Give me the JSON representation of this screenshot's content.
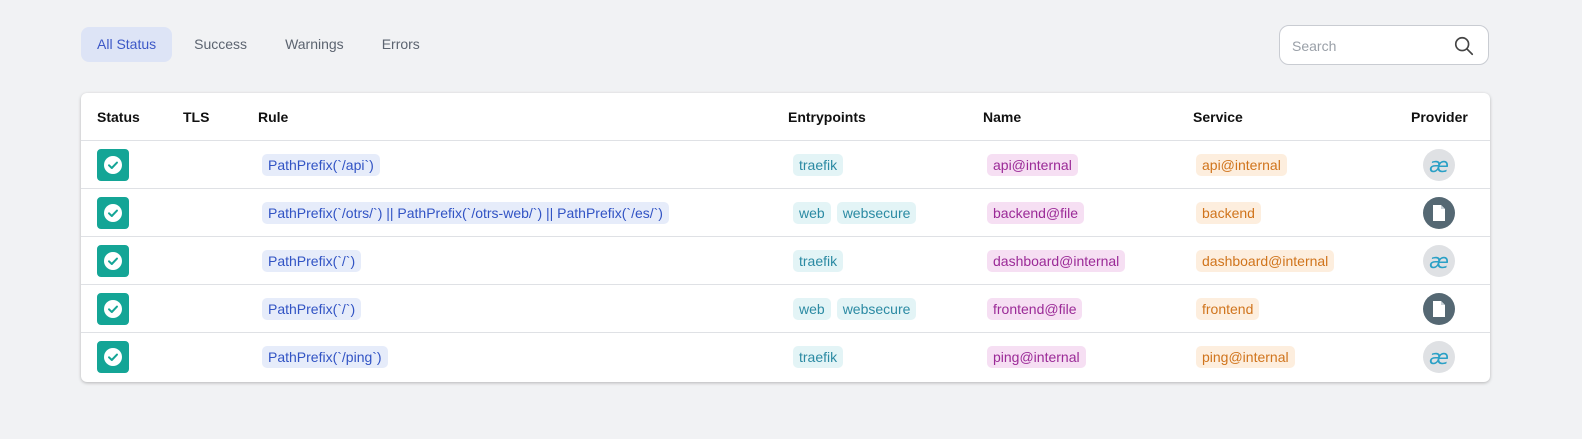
{
  "filters": {
    "tabs": [
      {
        "label": "All Status"
      },
      {
        "label": "Success"
      },
      {
        "label": "Warnings"
      },
      {
        "label": "Errors"
      }
    ],
    "active": "All Status"
  },
  "search": {
    "placeholder": "Search",
    "value": ""
  },
  "table": {
    "columns": [
      "Status",
      "TLS",
      "Rule",
      "Entrypoints",
      "Name",
      "Service",
      "Provider"
    ],
    "rows": [
      {
        "status": "success",
        "tls": "",
        "rule": "PathPrefix(`/api`)",
        "entrypoints": [
          "traefik"
        ],
        "name": "api@internal",
        "service": "api@internal",
        "provider": "internal"
      },
      {
        "status": "success",
        "tls": "",
        "rule": "PathPrefix(`/otrs/`) || PathPrefix(`/otrs-web/`) || PathPrefix(`/es/`)",
        "entrypoints": [
          "web",
          "websecure"
        ],
        "name": "backend@file",
        "service": "backend",
        "provider": "file"
      },
      {
        "status": "success",
        "tls": "",
        "rule": "PathPrefix(`/`)",
        "entrypoints": [
          "traefik"
        ],
        "name": "dashboard@internal",
        "service": "dashboard@internal",
        "provider": "internal"
      },
      {
        "status": "success",
        "tls": "",
        "rule": "PathPrefix(`/`)",
        "entrypoints": [
          "web",
          "websecure"
        ],
        "name": "frontend@file",
        "service": "frontend",
        "provider": "file"
      },
      {
        "status": "success",
        "tls": "",
        "rule": "PathPrefix(`/ping`)",
        "entrypoints": [
          "traefik"
        ],
        "name": "ping@internal",
        "service": "ping@internal",
        "provider": "internal"
      }
    ]
  },
  "icons": {
    "status": "check-circle-icon",
    "provider_internal": "ae-ligature-icon",
    "provider_file": "file-icon",
    "search": "search-icon"
  },
  "colors": {
    "success": "#14a596",
    "active_tab_bg": "#dde4f6",
    "active_tab_text": "#3d58c7"
  }
}
